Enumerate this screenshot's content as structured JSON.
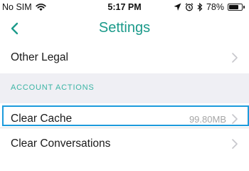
{
  "status_bar": {
    "carrier": "No SIM",
    "time": "5:17 PM",
    "battery_percent": "78%",
    "battery_level": 0.78
  },
  "nav": {
    "title": "Settings",
    "back_icon": "chevron-left-icon"
  },
  "rows": {
    "other_legal": {
      "label": "Other Legal"
    },
    "clear_cache": {
      "label": "Clear Cache",
      "value": "99.80MB"
    },
    "clear_conversations": {
      "label": "Clear Conversations"
    }
  },
  "sections": {
    "account_actions": {
      "header": "ACCOUNT ACTIONS"
    }
  },
  "colors": {
    "accent": "#1b9a8a",
    "section_header": "#3bb5a5",
    "section_bg": "#efeff4",
    "highlight": "#1d9bdc"
  }
}
